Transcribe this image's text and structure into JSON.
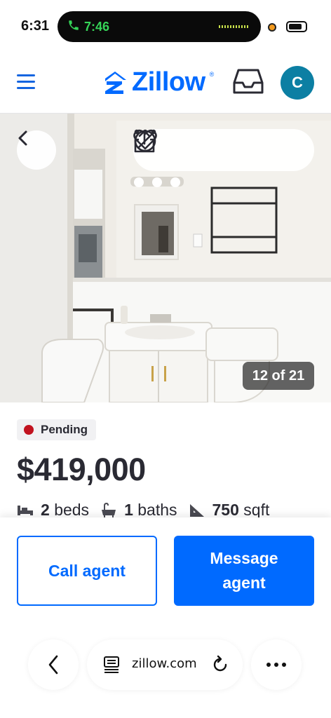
{
  "status_bar": {
    "time": "6:31",
    "call_duration": "7:46",
    "call_icon": "phone-icon",
    "recording_color": "#f39a1d"
  },
  "header": {
    "brand": "Zillow",
    "brand_mark": "®",
    "brand_color": "#006aff",
    "avatar_initial": "C",
    "avatar_color": "#0c7fa3",
    "menu_icon": "hamburger-menu-icon",
    "inbox_icon": "inbox-icon"
  },
  "photo": {
    "counter": "12 of 21",
    "actions": [
      "back-arrow-icon",
      "heart-icon",
      "share-icon",
      "hide-icon",
      "more-icon"
    ]
  },
  "listing": {
    "status": "Pending",
    "status_color": "#c1121f",
    "price": "$419,000",
    "beds_value": "2",
    "beds_label": "beds",
    "baths_value": "1",
    "baths_label": "baths",
    "sqft_value": "750",
    "sqft_label": "sqft"
  },
  "cta": {
    "call_label": "Call agent",
    "message_label": "Message agent"
  },
  "browser": {
    "url": "zillow.com",
    "icons": [
      "back-chevron-icon",
      "reader-mode-icon",
      "reload-icon",
      "more-icon"
    ]
  }
}
